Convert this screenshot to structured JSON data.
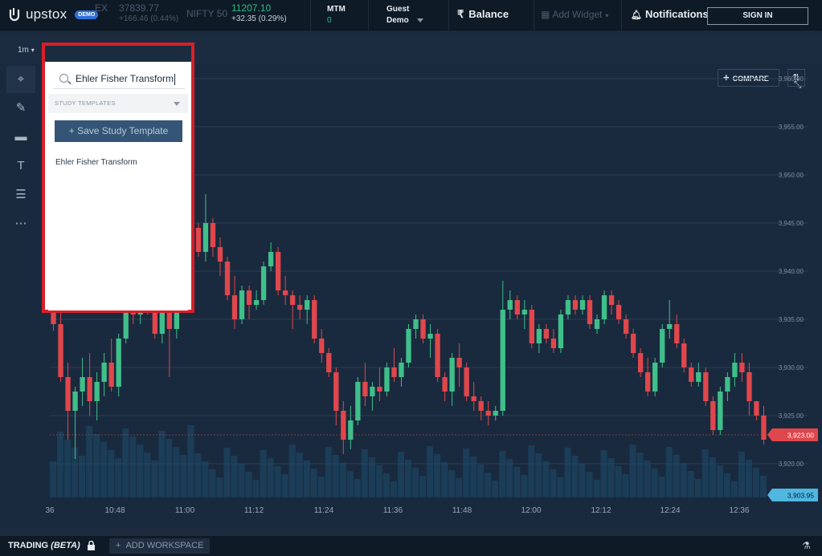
{
  "brand": {
    "name": "upstox",
    "badge": "DEMO"
  },
  "tickers": [
    {
      "name": "EX",
      "value": "37839.77",
      "change": "+166.46 (0.44%)"
    },
    {
      "name": "NIFTY 50",
      "value": "11207.10",
      "change": "+32.35 (0.29%)"
    }
  ],
  "mtm": {
    "label": "MTM",
    "value": "0"
  },
  "user": {
    "line1": "Guest",
    "line2": "Demo"
  },
  "nav": {
    "balance": "Balance",
    "add_widget": "Add Widget",
    "notifications": "Notifications",
    "sign_in": "SIGN IN"
  },
  "chart_toolbar": {
    "interval": "1m",
    "compare": "COMPARE"
  },
  "study_panel": {
    "search_value": "Ehler Fisher Transform",
    "templates_header": "STUDY TEMPLATES",
    "save_button": "+ Save Study Template",
    "results": [
      "Ehler Fisher Transform"
    ]
  },
  "workspace": {
    "trading_label": "TRADING",
    "beta_label": "(BETA)",
    "add_workspace": "ADD WORKSPACE"
  },
  "colors": {
    "up": "#3fbf8a",
    "down": "#e0474c",
    "volume": "#1e4d6b",
    "last_price_badge": "#e0474c",
    "volume_badge": "#4fb7e0"
  },
  "chart_data": {
    "type": "candlestick",
    "xlabel": "",
    "ylabel": "",
    "y_ticks": [
      "3,960.00",
      "3,955.00",
      "3,950.00",
      "3,945.00",
      "3,940.00",
      "3,935.00",
      "3,930.00",
      "3,925.00",
      "3,920.00"
    ],
    "y_tick_values": [
      3960,
      3955,
      3950,
      3945,
      3940,
      3935,
      3930,
      3925,
      3920
    ],
    "x_ticks": [
      "36",
      "10:48",
      "11:00",
      "11:12",
      "11:24",
      "11:36",
      "11:48",
      "12:00",
      "12:12",
      "12:24",
      "12:36"
    ],
    "ylim": [
      3916.5,
      3961.5
    ],
    "last_price": "3,923.00",
    "volume_label": "3,903.95",
    "grid": true,
    "candles": [
      [
        3940.5,
        3941.2,
        3933.8,
        3934.5
      ],
      [
        3934.5,
        3937.0,
        3928.5,
        3929.0
      ],
      [
        3929.0,
        3930.5,
        3922.5,
        3925.5
      ],
      [
        3925.5,
        3928.0,
        3920.5,
        3927.5
      ],
      [
        3927.5,
        3931.0,
        3926.0,
        3929.0
      ],
      [
        3929.0,
        3931.5,
        3925.0,
        3926.5
      ],
      [
        3926.5,
        3929.5,
        3924.5,
        3928.5
      ],
      [
        3928.5,
        3931.5,
        3927.0,
        3930.5
      ],
      [
        3930.5,
        3933.0,
        3927.5,
        3928.0
      ],
      [
        3928.0,
        3933.5,
        3927.0,
        3933.0
      ],
      [
        3933.0,
        3937.0,
        3932.5,
        3936.5
      ],
      [
        3936.5,
        3939.0,
        3934.5,
        3935.5
      ],
      [
        3935.5,
        3938.0,
        3934.5,
        3937.5
      ],
      [
        3937.5,
        3939.5,
        3935.5,
        3936.0
      ],
      [
        3936.0,
        3937.5,
        3933.0,
        3933.5
      ],
      [
        3933.5,
        3938.5,
        3932.5,
        3938.0
      ],
      [
        3938.0,
        3940.0,
        3929.0,
        3934.0
      ],
      [
        3934.0,
        3937.5,
        3933.0,
        3937.0
      ],
      [
        3937.0,
        3943.5,
        3936.5,
        3943.0
      ],
      [
        3943.0,
        3945.5,
        3941.0,
        3944.5
      ],
      [
        3944.5,
        3945.0,
        3941.5,
        3942.0
      ],
      [
        3942.0,
        3948.0,
        3941.0,
        3945.0
      ],
      [
        3945.0,
        3945.5,
        3941.5,
        3942.5
      ],
      [
        3942.5,
        3943.5,
        3939.5,
        3941.0
      ],
      [
        3941.0,
        3941.5,
        3937.0,
        3937.5
      ],
      [
        3937.5,
        3939.5,
        3934.0,
        3935.0
      ],
      [
        3935.0,
        3938.5,
        3934.5,
        3938.0
      ],
      [
        3938.0,
        3938.5,
        3935.0,
        3936.5
      ],
      [
        3936.5,
        3938.0,
        3936.0,
        3937.0
      ],
      [
        3937.0,
        3941.0,
        3936.5,
        3940.5
      ],
      [
        3940.5,
        3943.0,
        3940.0,
        3942.0
      ],
      [
        3942.0,
        3942.5,
        3937.5,
        3938.0
      ],
      [
        3938.0,
        3939.5,
        3936.5,
        3937.5
      ],
      [
        3937.5,
        3938.0,
        3934.0,
        3936.5
      ],
      [
        3936.5,
        3937.5,
        3935.0,
        3936.0
      ],
      [
        3936.0,
        3937.5,
        3934.5,
        3937.0
      ],
      [
        3937.0,
        3937.5,
        3932.5,
        3933.0
      ],
      [
        3933.0,
        3934.0,
        3930.5,
        3931.5
      ],
      [
        3931.5,
        3932.0,
        3929.0,
        3929.5
      ],
      [
        3929.5,
        3930.0,
        3924.0,
        3925.5
      ],
      [
        3925.5,
        3926.5,
        3921.0,
        3922.5
      ],
      [
        3922.5,
        3926.0,
        3921.5,
        3924.5
      ],
      [
        3924.5,
        3929.0,
        3924.0,
        3928.5
      ],
      [
        3928.5,
        3930.5,
        3926.0,
        3927.0
      ],
      [
        3927.0,
        3928.5,
        3925.5,
        3928.0
      ],
      [
        3928.0,
        3930.0,
        3926.5,
        3927.5
      ],
      [
        3927.5,
        3930.5,
        3927.0,
        3930.0
      ],
      [
        3930.0,
        3932.0,
        3928.5,
        3929.0
      ],
      [
        3929.0,
        3931.0,
        3928.0,
        3930.5
      ],
      [
        3930.5,
        3934.5,
        3930.0,
        3934.0
      ],
      [
        3934.0,
        3935.5,
        3933.0,
        3935.0
      ],
      [
        3935.0,
        3935.5,
        3932.5,
        3933.0
      ],
      [
        3933.0,
        3934.5,
        3931.0,
        3933.5
      ],
      [
        3933.5,
        3934.0,
        3928.5,
        3929.0
      ],
      [
        3929.0,
        3929.5,
        3926.5,
        3927.5
      ],
      [
        3927.5,
        3931.5,
        3926.0,
        3931.0
      ],
      [
        3931.0,
        3932.5,
        3928.0,
        3930.0
      ],
      [
        3930.0,
        3930.5,
        3926.5,
        3927.0
      ],
      [
        3927.0,
        3928.5,
        3925.5,
        3926.5
      ],
      [
        3926.5,
        3927.0,
        3924.5,
        3925.5
      ],
      [
        3925.5,
        3926.5,
        3924.0,
        3925.0
      ],
      [
        3925.0,
        3926.0,
        3924.5,
        3925.5
      ],
      [
        3925.5,
        3939.0,
        3925.0,
        3936.0
      ],
      [
        3936.0,
        3938.0,
        3935.0,
        3937.0
      ],
      [
        3937.0,
        3937.5,
        3935.0,
        3935.5
      ],
      [
        3935.5,
        3937.0,
        3934.0,
        3936.0
      ],
      [
        3936.0,
        3936.5,
        3932.0,
        3932.5
      ],
      [
        3932.5,
        3934.5,
        3931.5,
        3934.0
      ],
      [
        3934.0,
        3934.5,
        3932.5,
        3933.0
      ],
      [
        3933.0,
        3934.0,
        3931.5,
        3932.0
      ],
      [
        3932.0,
        3936.0,
        3931.5,
        3935.5
      ],
      [
        3935.5,
        3937.5,
        3935.0,
        3937.0
      ],
      [
        3937.0,
        3937.5,
        3935.5,
        3936.0
      ],
      [
        3936.0,
        3937.5,
        3935.5,
        3937.0
      ],
      [
        3937.0,
        3937.5,
        3934.0,
        3934.5
      ],
      [
        3934.0,
        3935.5,
        3933.5,
        3935.0
      ],
      [
        3935.0,
        3938.0,
        3934.5,
        3937.5
      ],
      [
        3937.5,
        3938.0,
        3935.5,
        3936.5
      ],
      [
        3936.5,
        3937.0,
        3934.5,
        3935.0
      ],
      [
        3935.0,
        3935.5,
        3933.0,
        3933.5
      ],
      [
        3933.5,
        3934.0,
        3931.0,
        3931.5
      ],
      [
        3931.5,
        3932.0,
        3929.0,
        3929.5
      ],
      [
        3929.5,
        3931.0,
        3927.0,
        3927.5
      ],
      [
        3927.5,
        3931.0,
        3927.0,
        3930.5
      ],
      [
        3930.5,
        3934.5,
        3930.0,
        3934.0
      ],
      [
        3934.0,
        3937.0,
        3933.0,
        3934.5
      ],
      [
        3934.5,
        3935.5,
        3932.0,
        3932.5
      ],
      [
        3932.5,
        3933.0,
        3929.5,
        3930.0
      ],
      [
        3930.0,
        3930.5,
        3928.0,
        3928.5
      ],
      [
        3928.5,
        3930.5,
        3928.0,
        3929.5
      ],
      [
        3929.5,
        3930.0,
        3926.0,
        3926.5
      ],
      [
        3926.5,
        3927.0,
        3923.0,
        3923.5
      ],
      [
        3923.5,
        3928.0,
        3923.0,
        3927.5
      ],
      [
        3927.5,
        3929.5,
        3926.5,
        3929.0
      ],
      [
        3929.0,
        3931.5,
        3928.0,
        3930.5
      ],
      [
        3930.5,
        3931.5,
        3928.5,
        3929.5
      ],
      [
        3929.5,
        3930.5,
        3925.0,
        3926.5
      ],
      [
        3926.5,
        3926.5,
        3924.5,
        3925.0
      ],
      [
        3925.0,
        3926.0,
        3922.0,
        3922.5
      ]
    ]
  }
}
